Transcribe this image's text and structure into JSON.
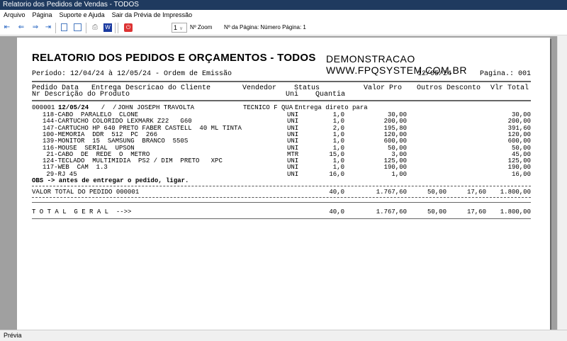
{
  "window": {
    "title": "Relatorio dos Pedidos de Vendas - TODOS"
  },
  "menu": [
    "Arquivo",
    "Página",
    "Suporte e Ajuda",
    "Sair da Prévia de Impressão"
  ],
  "toolbar": {
    "zoom_value": "1",
    "zoom_label": "Nº Zoom",
    "page_label": "Nº da Página: Número Página: 1"
  },
  "report": {
    "title": "RELATORIO DOS PEDIDOS E ORÇAMENTOS - TODOS",
    "company": "DEMONSTRACAO WWW.FPQSYSTEM.COM.BR",
    "period": "Período: 12/04/24 à 12/05/24 - Ordem de Emissão",
    "date": "12/05/24",
    "page": "Pagina.: 001",
    "headers1": {
      "pedido_data": "Pedido Data   Entrega Descricao do Cliente",
      "vendedor": "Vendedor",
      "status": "Status",
      "valor": "Valor Pro",
      "outros": "Outros Desconto",
      "total": "Vlr Total"
    },
    "headers2": {
      "nr": "Nr Descrição do Produto",
      "uni": "Uni",
      "quantia": "Quantia"
    },
    "order": {
      "nr": "000001",
      "date": "12/05/24",
      "entrega": "  /  /",
      "client": "JOHN JOSEPH TRAVOLTA",
      "vendedor": "TECNICO F QUA",
      "status": "Entrega direto para"
    },
    "items": [
      {
        "desc": "118-CABO  PARALELO  CLONE",
        "uni": "UNI",
        "qty": "1,0",
        "price": "30,00",
        "total": "30,00"
      },
      {
        "desc": "144-CARTUCHO COLORIDO LEXMARK Z22   G60",
        "uni": "UNI",
        "qty": "1,0",
        "price": "200,00",
        "total": "200,00"
      },
      {
        "desc": "147-CARTUCHO HP 640 PRETO FABER CASTELL  40 ML TINTA",
        "uni": "UNI",
        "qty": "2,0",
        "price": "195,80",
        "total": "391,60"
      },
      {
        "desc": "100-MEMORIA  DDR  512  PC  266",
        "uni": "UNI",
        "qty": "1,0",
        "price": "120,00",
        "total": "120,00"
      },
      {
        "desc": "139-MONITOR  15  SAMSUNG  BRANCO  550S",
        "uni": "UNI",
        "qty": "1,0",
        "price": "600,00",
        "total": "600,00"
      },
      {
        "desc": "116-MOUSE  SERIAL  UPSON",
        "uni": "UNI",
        "qty": "1,0",
        "price": "50,00",
        "total": "50,00"
      },
      {
        "desc": " 21-CABO  DE  REDE  O  METRO",
        "uni": "MTR",
        "qty": "15,0",
        "price": "3,00",
        "total": "45,00"
      },
      {
        "desc": "124-TECLADO  MULTIMIDIA  PS2 / DIM  PRETO   XPC",
        "uni": "UNI",
        "qty": "1,0",
        "price": "125,00",
        "total": "125,00"
      },
      {
        "desc": "117-WEB  CAM  1.3",
        "uni": "UNI",
        "qty": "1,0",
        "price": "190,00",
        "total": "190,00"
      },
      {
        "desc": " 29-RJ 45",
        "uni": "UNI",
        "qty": "16,0",
        "price": "1,00",
        "total": "16,00"
      }
    ],
    "obs": "OBS -> antes de entregar o pedido, ligar.",
    "order_total": {
      "label": "VALOR TOTAL DO PEDIDO 000001",
      "qty": "40,0",
      "valor": "1.767,60",
      "outros": "50,00",
      "desconto": "17,60",
      "total": "1.800,00"
    },
    "grand_total": {
      "label": "T O T A L  G E R A L  -->>",
      "qty": "40,0",
      "valor": "1.767,60",
      "outros": "50,00",
      "desconto": "17,60",
      "total": "1.800,00"
    }
  },
  "status": "Prévia"
}
